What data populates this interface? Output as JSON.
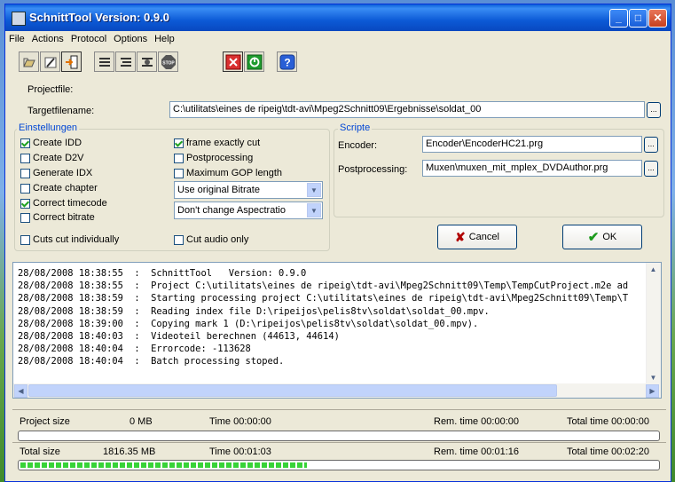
{
  "window": {
    "title": "SchnittTool  Version: 0.9.0"
  },
  "menu": [
    "File",
    "Actions",
    "Protocol",
    "Options",
    "Help"
  ],
  "toolbar": [
    "open-icon",
    "edit-icon",
    "exit-door-icon",
    "list-icon",
    "list-edit-icon",
    "list-process-icon",
    "stop-icon",
    "cancel-icon",
    "power-icon",
    "help-icon"
  ],
  "files": {
    "projectfile_label": "Projectfile:",
    "target_label": "Targetfilename:",
    "target_value": "C:\\utilitats\\eines de ripeig\\tdt-avi\\Mpeg2Schnitt09\\Ergebnisse\\soldat_00"
  },
  "einstellungen": {
    "label": "Einstellungen",
    "create_idd": "Create IDD",
    "create_d2v": "Create D2V",
    "generate_idx": "Generate IDX",
    "create_chapter": "Create chapter",
    "correct_timecode": "Correct timecode",
    "correct_bitrate": "Correct bitrate",
    "cuts_individually": "Cuts cut individually",
    "frame_exact": "frame exactly cut",
    "postprocessing": "Postprocessing",
    "max_gop": "Maximum GOP length",
    "bitrate_select": "Use original Bitrate",
    "aspect_select": "Don't change Aspectratio",
    "cut_audio": "Cut audio only"
  },
  "scripte": {
    "label": "Scripte",
    "encoder_label": "Encoder:",
    "encoder_value": "Encoder\\EncoderHC21.prg",
    "post_label": "Postprocessing:",
    "post_value": "Muxen\\muxen_mit_mplex_DVDAuthor.prg"
  },
  "buttons": {
    "cancel": "Cancel",
    "ok": "OK"
  },
  "log": [
    "28/08/2008 18:38:55  :  SchnittTool   Version: 0.9.0",
    "28/08/2008 18:38:55  :  Project C:\\utilitats\\eines de ripeig\\tdt-avi\\Mpeg2Schnitt09\\Temp\\TempCutProject.m2e ad",
    "28/08/2008 18:38:59  :  Starting processing project C:\\utilitats\\eines de ripeig\\tdt-avi\\Mpeg2Schnitt09\\Temp\\T",
    "28/08/2008 18:38:59  :  Reading index file D:\\ripeijos\\pelis8tv\\soldat\\soldat_00.mpv.",
    "28/08/2008 18:39:00  :  Copying mark 1 (D:\\ripeijos\\pelis8tv\\soldat\\soldat_00.mpv).",
    "28/08/2008 18:40:03  :  Videoteil berechnen (44613, 44614)",
    "28/08/2008 18:40:04  :  Errorcode: -113628",
    "28/08/2008 18:40:04  :  Batch processing stoped."
  ],
  "status": {
    "project_size_label": "Project size",
    "project_size": "0 MB",
    "project_time": "Time 00:00:00",
    "project_rem": "Rem. time 00:00:00",
    "project_total": "Total time 00:00:00",
    "project_progress": 0,
    "total_size_label": "Total size",
    "total_size": "1816.35 MB",
    "total_time": "Time 00:01:03",
    "total_rem": "Rem. time 00:01:16",
    "total_total": "Total time 00:02:20",
    "total_progress": 0.45
  }
}
